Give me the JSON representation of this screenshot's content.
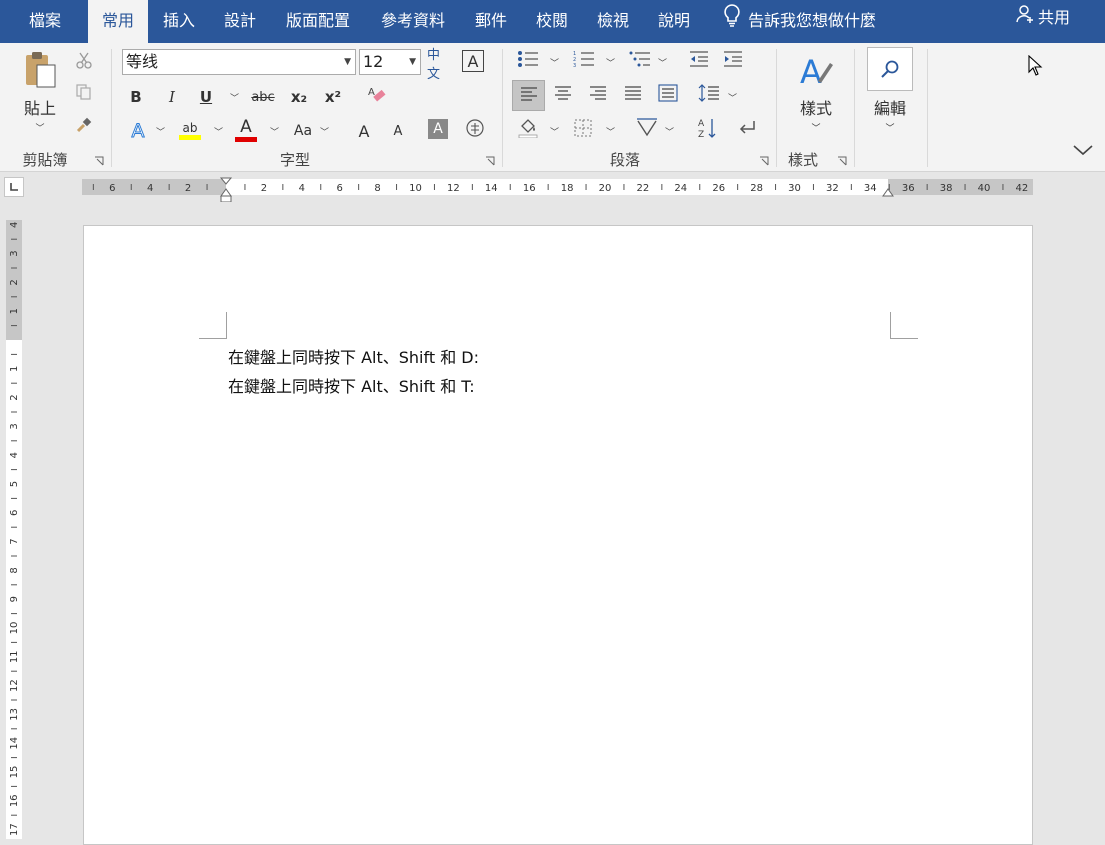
{
  "tabs": [
    {
      "label": "檔案",
      "active": false
    },
    {
      "label": "常用",
      "active": true
    },
    {
      "label": "插入",
      "active": false
    },
    {
      "label": "設計",
      "active": false
    },
    {
      "label": "版面配置",
      "active": false
    },
    {
      "label": "參考資料",
      "active": false
    },
    {
      "label": "郵件",
      "active": false
    },
    {
      "label": "校閱",
      "active": false
    },
    {
      "label": "檢視",
      "active": false
    },
    {
      "label": "說明",
      "active": false
    }
  ],
  "tell_me": "告訴我您想做什麼",
  "share": "共用",
  "ribbon": {
    "clipboard": {
      "label": "剪貼簿",
      "paste": "貼上"
    },
    "font": {
      "label": "字型",
      "font_name": "等线",
      "font_size": "12",
      "bold": "B",
      "italic": "I",
      "underline": "U",
      "strike": "abc",
      "sub": "x₂",
      "sup": "x²",
      "change_case": "Aa",
      "font_color_letter": "A",
      "highlight_letter": "ab",
      "phonetic": "中文",
      "grow": "A",
      "shrink": "A"
    },
    "paragraph": {
      "label": "段落"
    },
    "styles": {
      "label": "樣式",
      "button": "樣式"
    },
    "editing": {
      "button": "編輯"
    }
  },
  "ruler": {
    "horizontal_left": [
      "6",
      "4",
      "2"
    ],
    "horizontal_right": [
      "2",
      "4",
      "6",
      "8",
      "10",
      "12",
      "14",
      "16",
      "18",
      "20",
      "22",
      "24",
      "26",
      "28",
      "30",
      "32",
      "34",
      "36",
      "38",
      "40",
      "42"
    ],
    "vertical_top": [
      "4",
      "3",
      "2",
      "1"
    ],
    "vertical_bottom": [
      "1",
      "2",
      "3",
      "4",
      "5",
      "6",
      "7",
      "8",
      "9",
      "10",
      "11",
      "12",
      "13",
      "14",
      "15",
      "16",
      "17"
    ]
  },
  "document": {
    "lines": [
      "在鍵盤上同時按下 Alt、Shift 和 D:",
      "在鍵盤上同時按下 Alt、Shift 和 T:"
    ]
  },
  "colors": {
    "title_bar": "#2b579a",
    "ribbon_bg": "#f3f3f3",
    "highlight": "#ffff00",
    "font_color": "#e00000"
  }
}
